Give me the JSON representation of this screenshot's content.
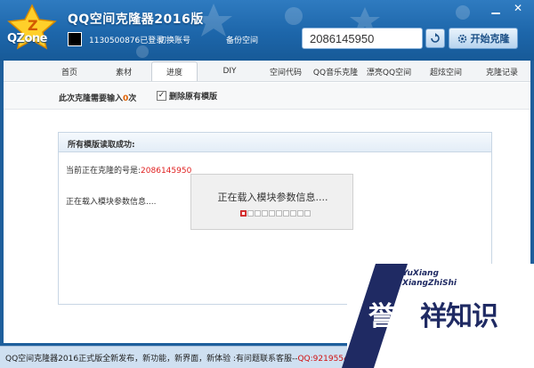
{
  "window": {
    "title": "QQ空间克隆器2016版",
    "logo_text": "QZone",
    "minimize": "▁",
    "close": "✕"
  },
  "account": {
    "login_text": "1130500876已登录",
    "switch_label": "切换账号",
    "backup_label": "备份空间"
  },
  "target": {
    "qq_value": "2086145950",
    "start_label": "开始克隆"
  },
  "nav": {
    "items": [
      {
        "label": "首页",
        "active": false
      },
      {
        "label": "素材",
        "active": false
      },
      {
        "label": "进度",
        "active": true
      },
      {
        "label": "DIY",
        "active": false
      },
      {
        "label": "空间代码",
        "active": false
      },
      {
        "label": "QQ音乐克隆",
        "active": false
      },
      {
        "label": "漂亮QQ空间",
        "active": false
      },
      {
        "label": "超炫空间",
        "active": false
      },
      {
        "label": "克隆记录",
        "active": false
      }
    ]
  },
  "clone_settings": {
    "input_prefix": "此次克隆需要输入",
    "input_count": "0",
    "input_suffix": "次",
    "delete_checked": true,
    "delete_label": "删除原有模版"
  },
  "content": {
    "header": "所有模版读取成功:",
    "current_prefix": "当前正在克隆的号是:",
    "current_qq": "2086145950",
    "loading_line": "正在载入模块参数信息....",
    "progress_text": "正在载入模块参数信息....",
    "progress_total": 10,
    "progress_done": 1
  },
  "status_bar": {
    "text": "QQ空间克隆器2016正式版全新发布，新功能，新界面，新体验 :有问题联系客服--",
    "qq": "QQ:921955472"
  },
  "watermark": {
    "en_line1": "YuXiang",
    "en_line2": "XiangZhiShi",
    "cn_part1": "誉祥",
    "cn_part2": "祥知识"
  },
  "colors": {
    "header_blue": "#1d66aa",
    "status_bar": "#cfe0f1",
    "accent_red": "#e02020",
    "watermark_navy": "#1f2a63"
  }
}
